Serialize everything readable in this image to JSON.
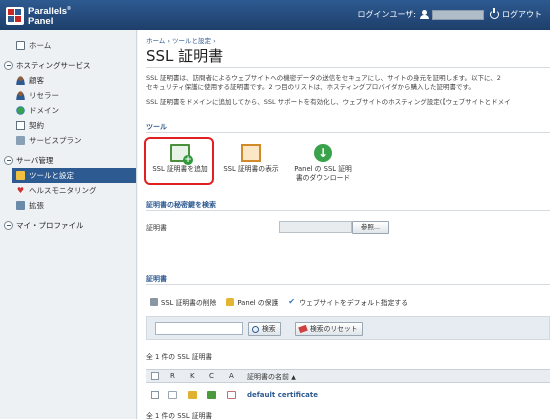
{
  "header": {
    "brand_line1": "Parallels",
    "brand_sup": "®",
    "brand_line2": "Panel",
    "login_user_label": "ログインユーザ:",
    "logout_label": "ログアウト"
  },
  "sidebar": {
    "home": "ホーム",
    "hosting_section": "ホスティングサービス",
    "hosting_items": [
      "顧客",
      "リセラー",
      "ドメイン",
      "契約",
      "サービスプラン"
    ],
    "server_section": "サーバ管理",
    "server_items": [
      "ツールと設定",
      "ヘルスモニタリング",
      "拡張"
    ],
    "profile_section": "マイ・プロファイル"
  },
  "main": {
    "breadcrumb": "ホーム › ツールと設定 ›",
    "title": "SSL 証明書",
    "desc_line1": "SSL 証明書は、訪問者によるウェブサイトへの機密データの送信をセキュアにし、サイトの身元を証明します。以下に、2",
    "desc_line2": "セキュリティ保護に使用する証明書です。2 つ目のリストは、ホスティングプロバイダから購入した証明書です。",
    "desc_line3": "SSL 証明書をドメインに追加してから、SSL サポートを有効化し、ウェブサイトのホスティング設定(【ウェブサイトとドメイ",
    "tools_heading": "ツール",
    "tools": [
      {
        "line1": "SSL 証明書を追加",
        "line2": ""
      },
      {
        "line1": "SSL 証明書の表示",
        "line2": ""
      },
      {
        "line1": "Panel の SSL 証明",
        "line2": "書のダウンロード"
      }
    ],
    "private_key_heading": "証明書の秘密鍵を検索",
    "cert_label": "証明書",
    "browse_label": "参照...",
    "certs_heading": "証明書",
    "toolbar": {
      "delete_label": "SSL 証明書の削除",
      "protect_label": "Panel の保護",
      "default_label": "ウェブサイトをデフォルト指定する"
    },
    "search_label": "検索",
    "reset_label": "検索のリセット",
    "count_top": "全 1 件の SSL 証明書",
    "count_bottom": "全 1 件の SSL 証明書",
    "table": {
      "col_r": "R",
      "col_k": "K",
      "col_c": "C",
      "col_a": "A",
      "col_name": "証明書の名前",
      "sort_indicator": "▲"
    },
    "rows": [
      {
        "name": "default certificate"
      }
    ]
  }
}
